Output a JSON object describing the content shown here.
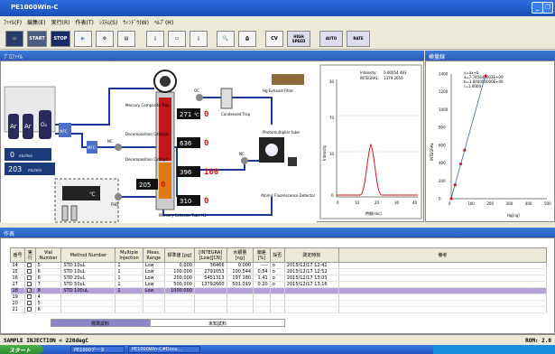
{
  "window": {
    "title": "PE1000Win-C"
  },
  "menu": [
    "ﾌｧｲﾙ(F)",
    "編集(E)",
    "実行(R)",
    "作表(T)",
    "ｼｽﾃﾑ(S)",
    "ｳｨﾝﾄﾞｳ(W)",
    "ﾍﾙﾌﾟ(H)"
  ],
  "toolbar": {
    "start": "START",
    "stop": "STOP",
    "cv": "CV",
    "high": "HIGH SPEED",
    "auto": "AUTO",
    "rate": "RATE"
  },
  "profile": {
    "title": "ﾌﾟﾛﾌｧｲﾙ",
    "labels": {
      "ar1": "Ar",
      "ar2": "Ar",
      "o2": "O₂",
      "mfc1": "MFC",
      "mfc2": "MFC",
      "mercury_trap": "Mercury Composite Trap",
      "decomp1": "Decomposition Catalyst",
      "decomp2": "Decomposition Catalyst",
      "condensed_trap": "Condensed Trap",
      "exhaust": "Hg Exhaust Filter",
      "photomult": "Photomultiplier tube",
      "detector": "Atomic Fluorescence Detector",
      "collector": "Mercury Collector Tube H2",
      "fhd": "FHD",
      "nc1": "NC",
      "nc2": "NC",
      "oc1": "OC",
      "oc2": "OC",
      "rd": "R/D"
    },
    "values": {
      "flow_ml": "0",
      "flow_ml_unit": "mL/min",
      "flow2": "203",
      "flow2_unit": "mL/min",
      "box_temp": "℃",
      "t1": "271",
      "t1_set": "0",
      "t2": "636",
      "t2_set": "0",
      "t3": "396",
      "t3_set": "100",
      "t4": "205",
      "t4_set": "0",
      "t5": "310",
      "t5_set": "0",
      "deg": "℃"
    },
    "plot": {
      "intensity_label": "Intensity:",
      "intensity": "0.00054 483",
      "integral_label": "INTEGRAL:",
      "integral": "1379.2656",
      "ylabel": "Intensity",
      "xlabel": "時間(sec)",
      "yticks": [
        "30",
        "70",
        "10",
        "0",
        "0"
      ],
      "xticks": [
        "0",
        "10",
        "20",
        "30",
        "40"
      ]
    }
  },
  "calibration": {
    "title": "検量線",
    "eq1": "y=ax+b",
    "eq2": "a=7.745640003E+00",
    "eq3": "b=3.840000000E+00",
    "eq4": "r=1.0000",
    "ylabel": "INTEGRAL",
    "xlabel": "Hg[ng]",
    "yticks": [
      "1400",
      "1200",
      "1000",
      "800",
      "600",
      "400",
      "200",
      "0"
    ],
    "xticks": [
      "0",
      "100",
      "200",
      "300",
      "400",
      "500"
    ]
  },
  "chart_data": {
    "type": "scatter",
    "title": "",
    "xlabel": "Hg[ng]",
    "ylabel": "INTEGRAL",
    "x": [
      0,
      20,
      50,
      70,
      180
    ],
    "y": [
      0,
      155,
      390,
      545,
      1379
    ],
    "xlim": [
      0,
      500
    ],
    "ylim": [
      0,
      1400
    ]
  },
  "worklist": {
    "title": "作表",
    "columns": [
      "番号",
      "実行",
      "Vial Number",
      "Method Number",
      "Multiple Injection",
      "Meas. Range",
      "標準値 [pg]",
      "[INTEGRA] [Low][CN]",
      "水銀量 [ng]",
      "偏差 [%]",
      "採否",
      "測定時刻",
      "備考"
    ],
    "rows": [
      {
        "no": "14",
        "chk": "",
        "vial": "5",
        "method": "STD 10uL",
        "mult": "1",
        "range": "Low",
        "std": "0.000",
        "integ": "36466",
        "hg": "0.000",
        "dev": "----",
        "ok": "o",
        "time": "2015/12/17 12:41",
        "sel": false
      },
      {
        "no": "15",
        "chk": "",
        "vial": "6",
        "method": "STD 10uL",
        "mult": "1",
        "range": "Low",
        "std": "100.000",
        "integ": "2791053",
        "hg": "100.544",
        "dev": "0.54",
        "ok": "o",
        "time": "2015/12/17 12:52",
        "sel": false
      },
      {
        "no": "16",
        "chk": "",
        "vial": "6",
        "method": "STD 20uL",
        "mult": "1",
        "range": "Low",
        "std": "200.000",
        "integ": "5451313",
        "hg": "197.180",
        "dev": "1.41",
        "ok": "o",
        "time": "2015/12/17 13:03",
        "sel": false
      },
      {
        "no": "17",
        "chk": "",
        "vial": "7",
        "method": "STD 50uL",
        "mult": "1",
        "range": "Low",
        "std": "500.000",
        "integ": "13792660",
        "hg": "501.019",
        "dev": "0.20",
        "ok": "o",
        "time": "2015/12/17 13:16",
        "sel": false
      },
      {
        "no": "18",
        "chk": "✓",
        "vial": "8",
        "method": "STD 100uL",
        "mult": "1",
        "range": "Low",
        "std": "1000.000",
        "integ": "",
        "hg": "",
        "dev": "",
        "ok": "",
        "time": "",
        "sel": true
      },
      {
        "no": "19",
        "chk": "",
        "vial": "4",
        "method": "",
        "mult": "",
        "range": "",
        "std": "",
        "integ": "",
        "hg": "",
        "dev": "",
        "ok": "",
        "time": "",
        "sel": false
      },
      {
        "no": "20",
        "chk": "",
        "vial": "5",
        "method": "",
        "mult": "",
        "range": "",
        "std": "",
        "integ": "",
        "hg": "",
        "dev": "",
        "ok": "",
        "time": "",
        "sel": false
      },
      {
        "no": "21",
        "chk": "",
        "vial": "6",
        "method": "",
        "mult": "",
        "range": "",
        "std": "",
        "integ": "",
        "hg": "",
        "dev": "",
        "ok": "",
        "time": "",
        "sel": false
      }
    ],
    "tabs": [
      "標準試料",
      "未知試料"
    ]
  },
  "status": {
    "left": "SAMPLE INJECTION   < 220degC",
    "right": "ROM: 2.0"
  },
  "taskbar": {
    "start": "スタート",
    "task1": "PE1000データ",
    "task2": "PE1000Win-C#Docu..."
  }
}
